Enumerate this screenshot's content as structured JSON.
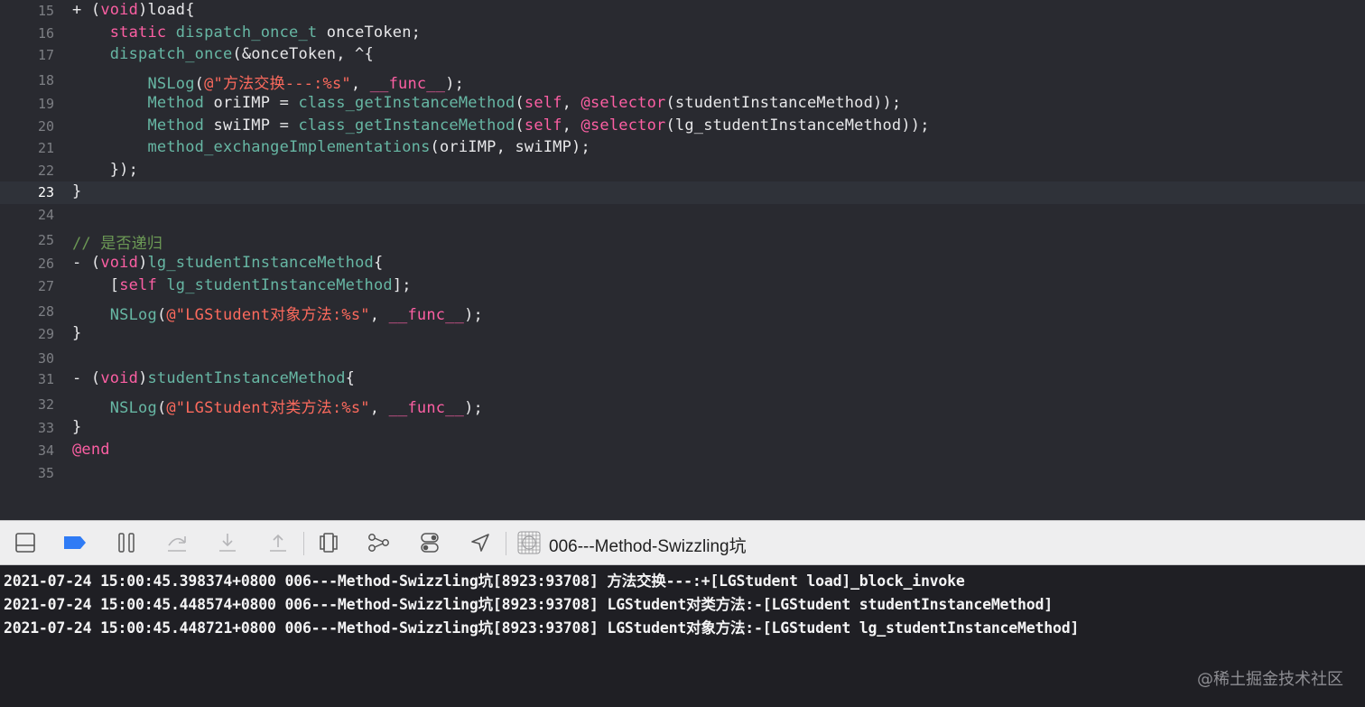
{
  "editor": {
    "lines": [
      {
        "n": "15",
        "html": "<span class=\"c-pl\">+ (</span><span class=\"c-kw\">void</span><span class=\"c-pl\">)load{</span>"
      },
      {
        "n": "16",
        "html": "    <span class=\"c-kw\">static</span> <span class=\"c-fn\">dispatch_once_t</span><span class=\"c-pl\"> onceToken;</span>"
      },
      {
        "n": "17",
        "html": "    <span class=\"c-fn\">dispatch_once</span><span class=\"c-pl\">(&amp;onceToken, ^{</span>"
      },
      {
        "n": "18",
        "html": "        <span class=\"c-fn\">NSLog</span><span class=\"c-pl\">(</span><span class=\"c-str\">@\"方法交换---:%s\"</span><span class=\"c-pl\">, </span><span class=\"c-kw\">__func__</span><span class=\"c-pl\">);</span>"
      },
      {
        "n": "19",
        "html": "        <span class=\"c-fn\">Method</span><span class=\"c-pl\"> oriIMP = </span><span class=\"c-fn\">class_getInstanceMethod</span><span class=\"c-pl\">(</span><span class=\"c-kw\">self</span><span class=\"c-pl\">, </span><span class=\"c-kw\">@selector</span><span class=\"c-pl\">(studentInstanceMethod));</span>"
      },
      {
        "n": "20",
        "html": "        <span class=\"c-fn\">Method</span><span class=\"c-pl\"> swiIMP = </span><span class=\"c-fn\">class_getInstanceMethod</span><span class=\"c-pl\">(</span><span class=\"c-kw\">self</span><span class=\"c-pl\">, </span><span class=\"c-kw\">@selector</span><span class=\"c-pl\">(lg_studentInstanceMethod));</span>"
      },
      {
        "n": "21",
        "html": "        <span class=\"c-fn\">method_exchangeImplementations</span><span class=\"c-pl\">(oriIMP, swiIMP);</span>"
      },
      {
        "n": "22",
        "html": "<span class=\"c-pl\">    });</span>"
      },
      {
        "n": "23",
        "html": "<span class=\"c-pl\">}</span>",
        "current": true
      },
      {
        "n": "24",
        "html": ""
      },
      {
        "n": "25",
        "html": "<span class=\"c-cm\">// 是否递归</span>"
      },
      {
        "n": "26",
        "html": "<span class=\"c-pl\">- (</span><span class=\"c-kw\">void</span><span class=\"c-pl\">)</span><span class=\"c-fn\">lg_studentInstanceMethod</span><span class=\"c-pl\">{</span>"
      },
      {
        "n": "27",
        "html": "<span class=\"c-pl\">    [</span><span class=\"c-kw\">self</span><span class=\"c-pl\"> </span><span class=\"c-fn\">lg_studentInstanceMethod</span><span class=\"c-pl\">];</span>"
      },
      {
        "n": "28",
        "html": "    <span class=\"c-fn\">NSLog</span><span class=\"c-pl\">(</span><span class=\"c-str\">@\"LGStudent对象方法:%s\"</span><span class=\"c-pl\">, </span><span class=\"c-kw\">__func__</span><span class=\"c-pl\">);</span>"
      },
      {
        "n": "29",
        "html": "<span class=\"c-pl\">}</span>"
      },
      {
        "n": "30",
        "html": ""
      },
      {
        "n": "31",
        "html": "<span class=\"c-pl\">- (</span><span class=\"c-kw\">void</span><span class=\"c-pl\">)</span><span class=\"c-fn\">studentInstanceMethod</span><span class=\"c-pl\">{</span>"
      },
      {
        "n": "32",
        "html": "    <span class=\"c-fn\">NSLog</span><span class=\"c-pl\">(</span><span class=\"c-str\">@\"LGStudent对类方法:%s\"</span><span class=\"c-pl\">, </span><span class=\"c-kw\">__func__</span><span class=\"c-pl\">);</span>"
      },
      {
        "n": "33",
        "html": "<span class=\"c-pl\">}</span>"
      },
      {
        "n": "34",
        "html": "<span class=\"c-at\">@end</span>"
      },
      {
        "n": "35",
        "html": ""
      }
    ]
  },
  "debugbar": {
    "target_label": "006---Method-Swizzling坑",
    "icons": [
      "hide-debug-area-icon",
      "breakpoints-icon",
      "pause-icon",
      "step-over-icon",
      "step-into-icon",
      "step-out-icon",
      "view-hierarchy-icon",
      "memory-graph-icon",
      "environment-overrides-icon",
      "simulate-location-icon",
      "target-icon"
    ],
    "accent": "#2f7bf5"
  },
  "console": {
    "lines": [
      "2021-07-24 15:00:45.398374+0800 006---Method-Swizzling坑[8923:93708] 方法交换---:+[LGStudent load]_block_invoke",
      "2021-07-24 15:00:45.448574+0800 006---Method-Swizzling坑[8923:93708] LGStudent对类方法:-[LGStudent studentInstanceMethod]",
      "2021-07-24 15:00:45.448721+0800 006---Method-Swizzling坑[8923:93708] LGStudent对象方法:-[LGStudent lg_studentInstanceMethod]"
    ]
  },
  "watermark": "@稀土掘金技术社区"
}
